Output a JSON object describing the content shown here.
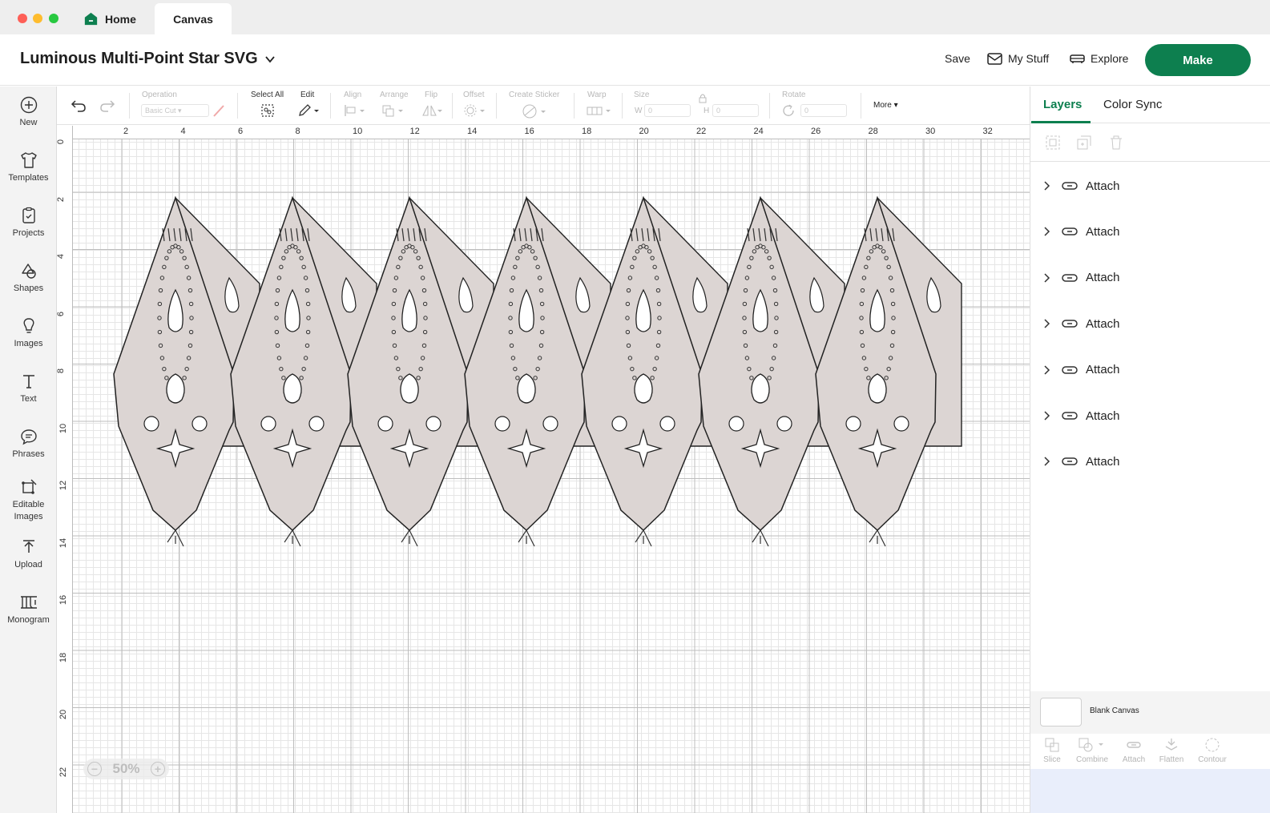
{
  "window": {
    "tabs": [
      {
        "label": "Home",
        "icon": "home-icon"
      },
      {
        "label": "Canvas"
      }
    ]
  },
  "header": {
    "project_title": "Luminous Multi-Point Star SVG",
    "save_label": "Save",
    "mystuff_label": "My Stuff",
    "explore_label": "Explore",
    "make_label": "Make",
    "accent_color": "#0d7f4f"
  },
  "left_rail": {
    "items": [
      {
        "label": "New",
        "icon": "plus-circle-icon"
      },
      {
        "label": "Templates",
        "icon": "tshirt-icon"
      },
      {
        "label": "Projects",
        "icon": "clipboard-icon"
      },
      {
        "label": "Shapes",
        "icon": "shapes-icon"
      },
      {
        "label": "Images",
        "icon": "lightbulb-icon"
      },
      {
        "label": "Text",
        "icon": "text-icon"
      },
      {
        "label": "Phrases",
        "icon": "speech-bubble-icon"
      },
      {
        "label": "Editable Images",
        "icon": "editable-image-icon"
      },
      {
        "label": "Upload",
        "icon": "upload-icon"
      },
      {
        "label": "Monogram",
        "icon": "monogram-icon"
      }
    ]
  },
  "toolbar": {
    "operation_label": "Operation",
    "operation_value": "Basic Cut",
    "select_all_label": "Select All",
    "edit_label": "Edit",
    "align_label": "Align",
    "arrange_label": "Arrange",
    "flip_label": "Flip",
    "offset_label": "Offset",
    "create_sticker_label": "Create Sticker",
    "warp_label": "Warp",
    "size_label": "Size",
    "width_label": "W",
    "width_value": "0",
    "height_label": "H",
    "height_value": "0",
    "rotate_label": "Rotate",
    "rotate_value": "0",
    "more_label": "More"
  },
  "canvas": {
    "ruler_top": [
      "2",
      "4",
      "6",
      "8",
      "10",
      "12",
      "14",
      "16",
      "18",
      "20",
      "22",
      "24",
      "26",
      "28",
      "30",
      "32"
    ],
    "ruler_left": [
      "0",
      "2",
      "4",
      "6",
      "8",
      "10",
      "12",
      "14",
      "16",
      "18",
      "20",
      "22"
    ],
    "zoom_label": "50%",
    "shape_fill": "#dcd5d3"
  },
  "right_panel": {
    "tab_layers": "Layers",
    "tab_color_sync": "Color Sync",
    "layers": [
      {
        "label": "Attach"
      },
      {
        "label": "Attach"
      },
      {
        "label": "Attach"
      },
      {
        "label": "Attach"
      },
      {
        "label": "Attach"
      },
      {
        "label": "Attach"
      },
      {
        "label": "Attach"
      }
    ],
    "blank_canvas_label": "Blank Canvas",
    "bottom_tools": [
      "Slice",
      "Combine",
      "Attach",
      "Flatten",
      "Contour"
    ]
  }
}
